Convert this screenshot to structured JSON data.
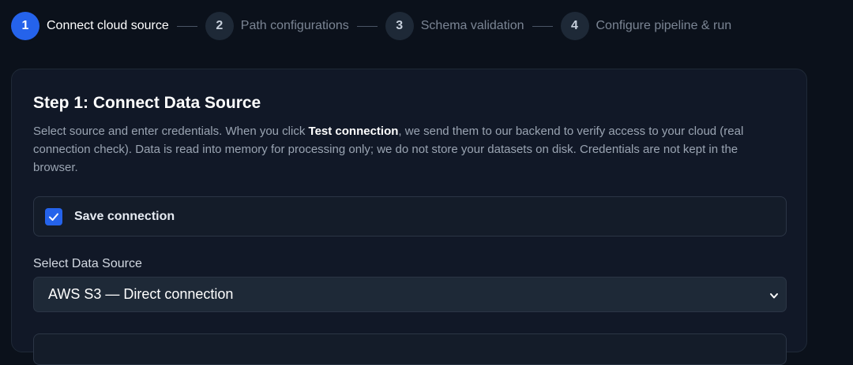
{
  "stepper": {
    "steps": [
      {
        "number": "1",
        "label": "Connect cloud source",
        "state": "active"
      },
      {
        "number": "2",
        "label": "Path configurations",
        "state": "inactive"
      },
      {
        "number": "3",
        "label": "Schema validation",
        "state": "inactive"
      },
      {
        "number": "4",
        "label": "Configure pipeline & run",
        "state": "inactive"
      }
    ]
  },
  "card": {
    "title": "Step 1: Connect Data Source",
    "description_before": "Select source and enter credentials. When you click ",
    "description_bold": "Test connection",
    "description_after": ", we send them to our backend to verify access to your cloud (real connection check). Data is read into memory for processing only; we do not store your datasets on disk. Credentials are not kept in the browser."
  },
  "save_connection": {
    "label": "Save connection",
    "checked": true,
    "icon": "check-icon"
  },
  "data_source": {
    "label": "Select Data Source",
    "selected": "AWS S3 — Direct connection",
    "icon": "chevron-down-icon"
  },
  "colors": {
    "accent": "#2563eb",
    "background": "#0b111b",
    "card": "#111827"
  }
}
